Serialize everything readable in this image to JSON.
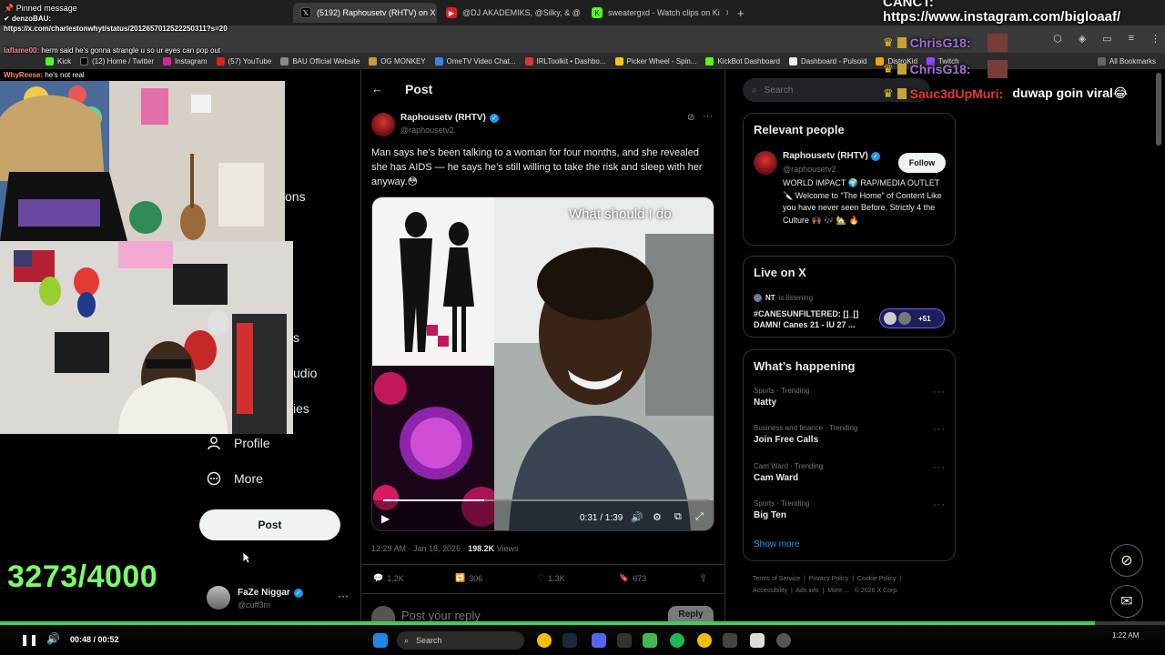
{
  "tabs": [
    {
      "label": "(5192) Raphousetv (RHTV) on X",
      "active": true
    },
    {
      "label": "@DJ AKADEMIKS, @Silky, & @",
      "active": false
    },
    {
      "label": "sweatergxd - Watch clips on Ki",
      "active": false
    }
  ],
  "bookmarks": [
    "Kick",
    "(12) Home / Twitter",
    "Instagram",
    "(57) YouTube",
    "BAU Official Website",
    "OG MONKEY",
    "OmeTV Video Chat...",
    "IRLToolkit • Dashbo...",
    "Picker Wheel - Spin...",
    "KickBot Dashboard",
    "Dashboard - Pulsoid",
    "DistroKid",
    "Twitch",
    "All Bookmarks"
  ],
  "chat": {
    "pinned_label": "Pinned message",
    "pinned_user": "denzoBAU:",
    "pinned_url": "https://x.com/charlestonwhyt/status/2012657012522250311?s=20",
    "lines": [
      {
        "user": "laflame00:",
        "text": "herm said he's gonna strangle u so ur eyes can pop out"
      },
      {
        "user": "WhyReese:",
        "text": "he's not real"
      }
    ]
  },
  "right_chat": {
    "top_text": "CANCT:",
    "url": "https://www.instagram.com/bigloaaf/",
    "user1": "ChrisG18:",
    "user2": "ChrisG18:",
    "user3": "Sauc3dUpMuri:",
    "msg3": "duwap goin viral😂"
  },
  "nav": {
    "partial1": "ons",
    "partial2": "s",
    "partial3": "udio",
    "partial4": "ies",
    "profile": "Profile",
    "more": "More",
    "post_button": "Post",
    "account_name": "FaZe Niggar",
    "account_handle": "@cuff3m"
  },
  "counter": "3273/4000",
  "post": {
    "header": "Post",
    "author": "Raphousetv (RHTV)",
    "handle": "@raphousetv2",
    "text": "Man says he’s been talking to a woman for four months, and she revealed she has AIDS — he says he’s still willing to take the risk and sleep with her anyway.😳",
    "video_caption": "What should I do",
    "video_time": "0:31 / 1:39",
    "video_progress": 0.31,
    "timestamp": "12:29 AM · Jan 18, 2026",
    "views_count": "198.2K",
    "views_label": "Views",
    "replies": "1.2K",
    "reposts": "306",
    "likes": "1.3K",
    "bookmarks": "673",
    "reply_placeholder": "Post your reply",
    "reply_button": "Reply"
  },
  "search": {
    "placeholder": "Search"
  },
  "relevant": {
    "title": "Relevant people",
    "name": "Raphousetv (RHTV)",
    "handle": "@raphousetv2",
    "follow": "Follow",
    "bio": "WORLD IMPACT 🌍 RAP/MEDIA OUTLET 🔪 Welcome to “The Home” of Content Like you have never seen Before. Strictly 4 the Culture 🙌🏾 🎶 🏡 🔥"
  },
  "live": {
    "title": "Live on X",
    "host": "NT",
    "status": "is listening",
    "space_title": "#CANESUNFILTERED: []_[] DAMN! Canes 21 - IU 27 ...",
    "listeners": "+51"
  },
  "happening": {
    "title": "What’s happening",
    "trends": [
      {
        "category": "Sports · Trending",
        "name": "Natty"
      },
      {
        "category": "Business and finance · Trending",
        "name": "Join Free Calls"
      },
      {
        "category": "Cam Ward · Trending",
        "name": "Cam Ward"
      },
      {
        "category": "Sports · Trending",
        "name": "Big Ten"
      }
    ],
    "show_more": "Show more"
  },
  "footer": {
    "links": [
      "Terms of Service",
      "Privacy Policy",
      "Cookie Policy",
      "Accessibility",
      "Ads info",
      "More ...",
      "© 2026 X Corp."
    ]
  },
  "player": {
    "time": "00:48 / 00:52",
    "progress": 0.94,
    "clock": "1:22 AM"
  },
  "taskbar": {
    "search_placeholder": "Search"
  },
  "colors": {
    "accent_green": "#39d353",
    "x_blue": "#1d9bf0",
    "counter_green": "#7cfc6a"
  }
}
